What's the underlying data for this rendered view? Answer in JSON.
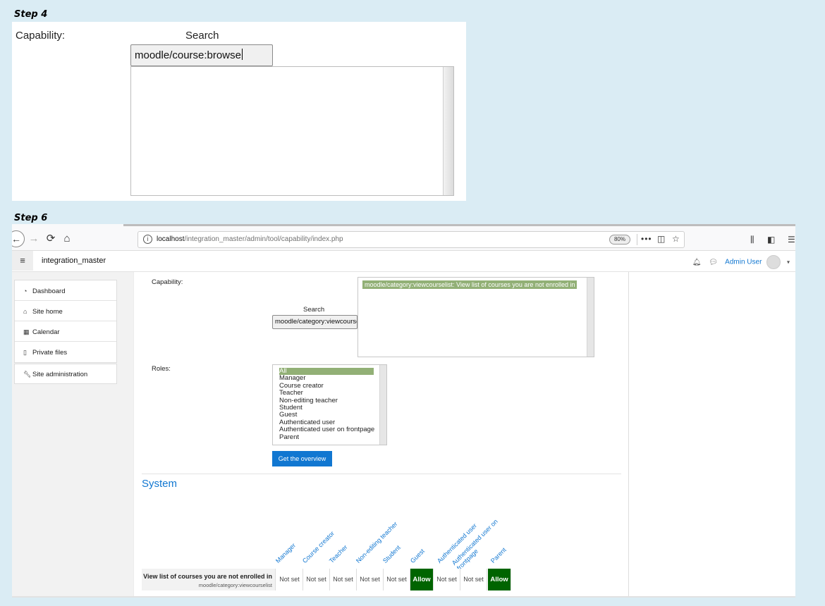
{
  "step4": {
    "label": "Step 4",
    "capability_label": "Capability:",
    "search_label": "Search",
    "search_value": "moodle/course:browse"
  },
  "step6": {
    "label": "Step 6",
    "browser": {
      "url_host": "localhost",
      "url_path": "/integration_master/admin/tool/capability/index.php",
      "zoom": "80%"
    },
    "header": {
      "site_name": "integration_master",
      "user_name": "Admin User"
    },
    "sidebar": {
      "items": [
        {
          "label": "Dashboard",
          "icon": "dashboard-icon"
        },
        {
          "label": "Site home",
          "icon": "home-icon"
        },
        {
          "label": "Calendar",
          "icon": "calendar-icon"
        },
        {
          "label": "Private files",
          "icon": "file-icon"
        }
      ],
      "admin_item": {
        "label": "Site administration",
        "icon": "wrench-icon"
      }
    },
    "form": {
      "capability_label": "Capability:",
      "capability_selected": "moodle/category:viewcourselist: View list of courses you are not enrolled in",
      "search_label": "Search",
      "search_value": "moodle/category:viewcourse",
      "roles_label": "Roles:",
      "roles": [
        "All",
        "Manager",
        "Course creator",
        "Teacher",
        "Non-editing teacher",
        "Student",
        "Guest",
        "Authenticated user",
        "Authenticated user on frontpage",
        "Parent"
      ],
      "roles_selected": "All",
      "button_label": "Get the overview"
    },
    "results": {
      "section_title": "System",
      "columns": [
        "Manager",
        "Course creator",
        "Teacher",
        "Non-editing teacher",
        "Student",
        "Guest",
        "Authenticated user",
        "Authenticated user on frontpage",
        "Parent"
      ],
      "row": {
        "title": "View list of courses you are not enrolled in",
        "capability": "moodle/category:viewcourselist",
        "values": [
          "Not set",
          "Not set",
          "Not set",
          "Not set",
          "Not set",
          "Allow",
          "Not set",
          "Not set",
          "Allow"
        ]
      }
    },
    "colors": {
      "accent": "#1177d1",
      "allow": "#006400",
      "selected": "#92b076"
    }
  }
}
